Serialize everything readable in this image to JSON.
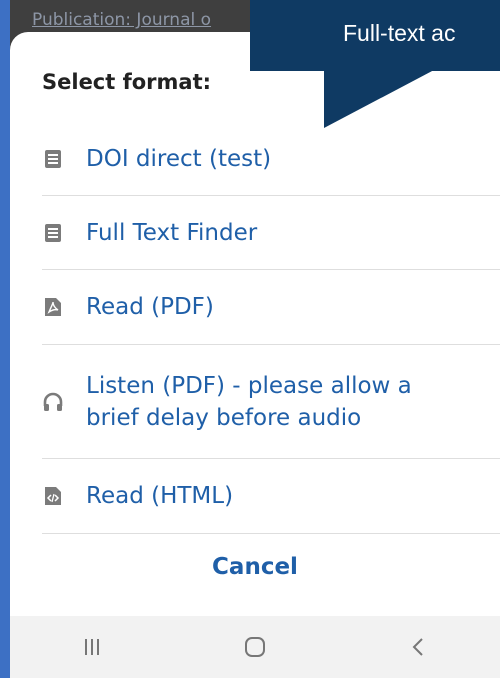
{
  "background": {
    "publication_text": "Publication: Journal o"
  },
  "tooltip": {
    "text": "Full-text ac"
  },
  "sheet": {
    "title": "Select format:",
    "options": [
      {
        "label": "DOI direct (test)",
        "icon": "document-icon"
      },
      {
        "label": "Full Text Finder",
        "icon": "document-icon"
      },
      {
        "label": "Read (PDF)",
        "icon": "pdf-icon"
      },
      {
        "label": "Listen (PDF) - please allow a brief delay before audio",
        "icon": "headphones-icon"
      },
      {
        "label": "Read (HTML)",
        "icon": "html-icon"
      }
    ],
    "cancel_label": "Cancel"
  },
  "navbar": {
    "items": [
      "recent-apps-icon",
      "home-icon",
      "back-icon"
    ]
  },
  "colors": {
    "accent": "#1f5fa8",
    "tooltip_bg": "#0f3a63",
    "icon_gray": "#7b7b7b",
    "divider": "#dedede"
  }
}
